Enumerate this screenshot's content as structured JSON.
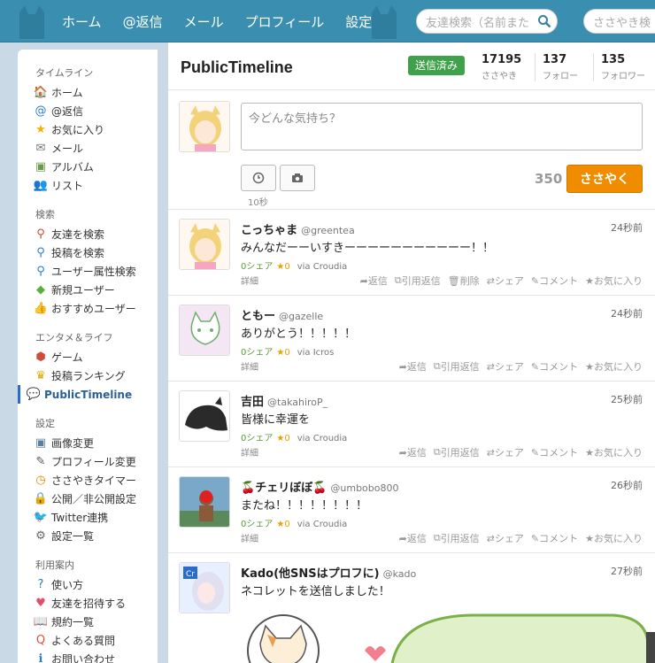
{
  "header": {
    "nav": [
      "ホーム",
      "@返信",
      "メール",
      "プロフィール",
      "設定"
    ],
    "search_friends_placeholder": "友達検索（名前また",
    "search_posts_placeholder": "ささやき検"
  },
  "sidebar": {
    "sections": [
      {
        "title": "タイムライン",
        "items": [
          {
            "label": "ホーム",
            "icon": "house-icon"
          },
          {
            "label": "@返信",
            "icon": "at-icon"
          },
          {
            "label": "お気に入り",
            "icon": "star-icon"
          },
          {
            "label": "メール",
            "icon": "mail-icon"
          },
          {
            "label": "アルバム",
            "icon": "album-icon"
          },
          {
            "label": "リスト",
            "icon": "users-icon"
          }
        ]
      },
      {
        "title": "検索",
        "items": [
          {
            "label": "友達を検索",
            "icon": "user-search-icon"
          },
          {
            "label": "投稿を検索",
            "icon": "post-search-icon"
          },
          {
            "label": "ユーザー属性検索",
            "icon": "attribute-search-icon"
          },
          {
            "label": "新規ユーザー",
            "icon": "beginner-icon"
          },
          {
            "label": "おすすめユーザー",
            "icon": "thumbs-up-icon"
          }
        ]
      },
      {
        "title": "エンタメ＆ライフ",
        "items": [
          {
            "label": "ゲーム",
            "icon": "dice-icon"
          },
          {
            "label": "投稿ランキング",
            "icon": "crown-icon"
          },
          {
            "label": "PublicTimeline",
            "icon": "chat-icon",
            "active": true
          }
        ]
      },
      {
        "title": "設定",
        "items": [
          {
            "label": "画像変更",
            "icon": "image-icon"
          },
          {
            "label": "プロフィール変更",
            "icon": "pencil-icon"
          },
          {
            "label": "ささやきタイマー",
            "icon": "timer-icon"
          },
          {
            "label": "公開／非公開設定",
            "icon": "lock-icon"
          },
          {
            "label": "Twitter連携",
            "icon": "twitter-icon"
          },
          {
            "label": "設定一覧",
            "icon": "gear-icon"
          }
        ]
      },
      {
        "title": "利用案内",
        "items": [
          {
            "label": "使い方",
            "icon": "question-icon"
          },
          {
            "label": "友達を招待する",
            "icon": "heart-icon"
          },
          {
            "label": "規約一覧",
            "icon": "book-icon"
          },
          {
            "label": "よくある質問",
            "icon": "faq-icon"
          },
          {
            "label": "お問い合わせ",
            "icon": "info-icon"
          }
        ]
      }
    ]
  },
  "main": {
    "title": "PublicTimeline",
    "sent_badge": "送信済み",
    "stats": [
      {
        "value": "17195",
        "label": "ささやき"
      },
      {
        "value": "137",
        "label": "フォロー"
      },
      {
        "value": "135",
        "label": "フォロワー"
      }
    ]
  },
  "compose": {
    "placeholder": "今どんな気持ち？",
    "timer_label": "10秒",
    "char_count": "350",
    "submit_label": "ささやく"
  },
  "posts": [
    {
      "name": "こっちゃま",
      "handle": "@greentea",
      "time": "24秒前",
      "text": "みんなだーーいすきーーーーーーーーーーー！！",
      "shares": "0シェア",
      "stars": "★0",
      "via": "via Croudia",
      "detail": "詳細",
      "actions": [
        "返信",
        "引用返信",
        "削除",
        "シェア",
        "コメント",
        "お気に入り"
      ]
    },
    {
      "name": "ともー",
      "handle": "@gazelle",
      "time": "24秒前",
      "text": "ありがとう！！！！！",
      "shares": "0シェア",
      "stars": "★0",
      "via": "via Icros",
      "detail": "詳細",
      "actions": [
        "返信",
        "引用返信",
        "シェア",
        "コメント",
        "お気に入り"
      ]
    },
    {
      "name": "吉田",
      "handle": "@takahiroP_",
      "time": "25秒前",
      "text": "皆様に幸運を",
      "shares": "0シェア",
      "stars": "★0",
      "via": "via Croudia",
      "detail": "詳細",
      "actions": [
        "返信",
        "引用返信",
        "シェア",
        "コメント",
        "お気に入り"
      ]
    },
    {
      "name": "チェリぼぼ",
      "handle": "@umbobo800",
      "time": "26秒前",
      "text": "またね！！！！！！！！",
      "shares": "0シェア",
      "stars": "★0",
      "via": "via Croudia",
      "detail": "詳細",
      "actions": [
        "返信",
        "引用返信",
        "シェア",
        "コメント",
        "お気に入り"
      ]
    },
    {
      "name": "Kado(他SNSはプロフに)",
      "handle": "@kado",
      "time": "27秒前",
      "text": "ネコレットを送信しました！"
    }
  ],
  "colors": {
    "header": "#3a8fb0",
    "post_button": "#f08c00",
    "sent_badge": "#3fa24a",
    "active_nav": "#2a6cc9"
  }
}
